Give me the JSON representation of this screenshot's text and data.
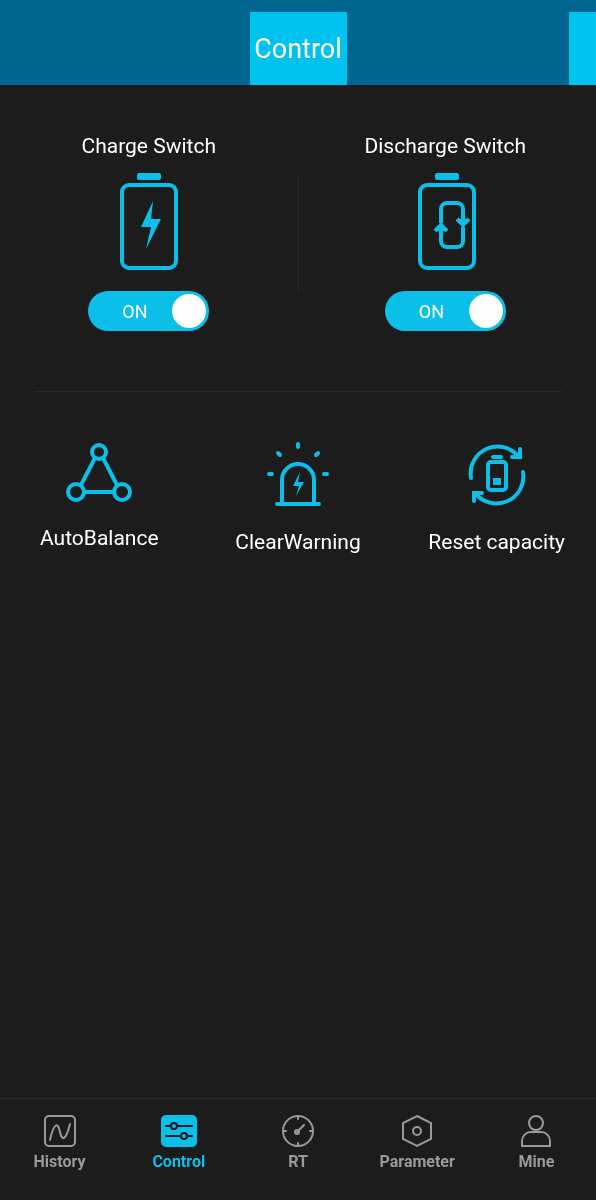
{
  "header": {
    "title": "Control"
  },
  "switches": [
    {
      "label": "Charge Switch",
      "kind": "charge",
      "toggle": "ON",
      "on": true
    },
    {
      "label": "Discharge Switch",
      "kind": "cycle",
      "toggle": "ON",
      "on": true
    }
  ],
  "actions": [
    {
      "label": "AutoBalance",
      "kind": "balance"
    },
    {
      "label": "ClearWarning",
      "kind": "alarm"
    },
    {
      "label": "Reset capacity",
      "kind": "reset"
    }
  ],
  "tabs": [
    {
      "label": "History",
      "kind": "history",
      "selected": false
    },
    {
      "label": "Control",
      "kind": "control",
      "selected": true
    },
    {
      "label": "RT",
      "kind": "gauge",
      "selected": false
    },
    {
      "label": "Parameter",
      "kind": "parameter",
      "selected": false
    },
    {
      "label": "Mine",
      "kind": "user",
      "selected": false
    }
  ]
}
